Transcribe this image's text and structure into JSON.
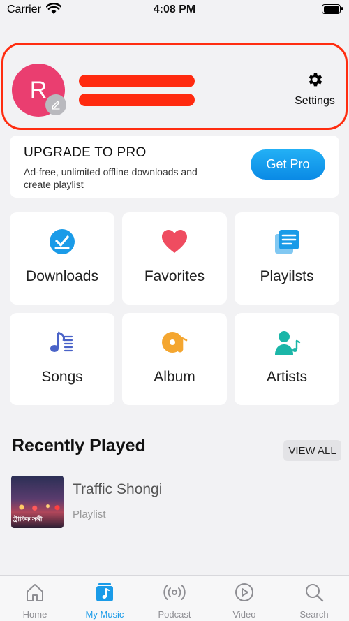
{
  "status_bar": {
    "carrier": "Carrier",
    "time": "4:08 PM"
  },
  "profile": {
    "avatar_initial": "R",
    "settings_label": "Settings"
  },
  "upgrade": {
    "title": "UPGRADE TO PRO",
    "description": "Ad-free, unlimited offline downloads and create playlist",
    "button_label": "Get Pro"
  },
  "grid": {
    "downloads": "Downloads",
    "favorites": "Favorites",
    "playlists": "Playilsts",
    "songs": "Songs",
    "album": "Album",
    "artists": "Artists"
  },
  "recently_played": {
    "title": "Recently Played",
    "view_all": "VIEW ALL",
    "items": [
      {
        "title": "Traffic Shongi",
        "subtitle": "Playlist",
        "thumb_text": "ট্রাফিক সঙ্গী"
      }
    ]
  },
  "tabs": [
    {
      "label": "Home"
    },
    {
      "label": "My Music"
    },
    {
      "label": "Podcast"
    },
    {
      "label": "Video"
    },
    {
      "label": "Search"
    }
  ],
  "colors": {
    "accent": "#1a9be8",
    "avatar": "#ea3e70",
    "highlight": "#ff2d10",
    "favorites": "#ef4c60",
    "album": "#f4a630",
    "artists": "#1bb6a8",
    "songs": "#4a63c8"
  }
}
